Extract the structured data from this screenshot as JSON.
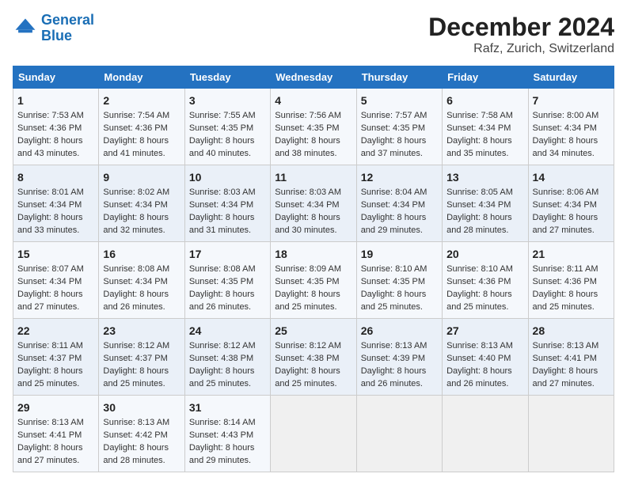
{
  "header": {
    "logo_line1": "General",
    "logo_line2": "Blue",
    "title": "December 2024",
    "subtitle": "Rafz, Zurich, Switzerland"
  },
  "columns": [
    "Sunday",
    "Monday",
    "Tuesday",
    "Wednesday",
    "Thursday",
    "Friday",
    "Saturday"
  ],
  "weeks": [
    [
      {
        "day": "1",
        "lines": [
          "Sunrise: 7:53 AM",
          "Sunset: 4:36 PM",
          "Daylight: 8 hours",
          "and 43 minutes."
        ]
      },
      {
        "day": "2",
        "lines": [
          "Sunrise: 7:54 AM",
          "Sunset: 4:36 PM",
          "Daylight: 8 hours",
          "and 41 minutes."
        ]
      },
      {
        "day": "3",
        "lines": [
          "Sunrise: 7:55 AM",
          "Sunset: 4:35 PM",
          "Daylight: 8 hours",
          "and 40 minutes."
        ]
      },
      {
        "day": "4",
        "lines": [
          "Sunrise: 7:56 AM",
          "Sunset: 4:35 PM",
          "Daylight: 8 hours",
          "and 38 minutes."
        ]
      },
      {
        "day": "5",
        "lines": [
          "Sunrise: 7:57 AM",
          "Sunset: 4:35 PM",
          "Daylight: 8 hours",
          "and 37 minutes."
        ]
      },
      {
        "day": "6",
        "lines": [
          "Sunrise: 7:58 AM",
          "Sunset: 4:34 PM",
          "Daylight: 8 hours",
          "and 35 minutes."
        ]
      },
      {
        "day": "7",
        "lines": [
          "Sunrise: 8:00 AM",
          "Sunset: 4:34 PM",
          "Daylight: 8 hours",
          "and 34 minutes."
        ]
      }
    ],
    [
      {
        "day": "8",
        "lines": [
          "Sunrise: 8:01 AM",
          "Sunset: 4:34 PM",
          "Daylight: 8 hours",
          "and 33 minutes."
        ]
      },
      {
        "day": "9",
        "lines": [
          "Sunrise: 8:02 AM",
          "Sunset: 4:34 PM",
          "Daylight: 8 hours",
          "and 32 minutes."
        ]
      },
      {
        "day": "10",
        "lines": [
          "Sunrise: 8:03 AM",
          "Sunset: 4:34 PM",
          "Daylight: 8 hours",
          "and 31 minutes."
        ]
      },
      {
        "day": "11",
        "lines": [
          "Sunrise: 8:03 AM",
          "Sunset: 4:34 PM",
          "Daylight: 8 hours",
          "and 30 minutes."
        ]
      },
      {
        "day": "12",
        "lines": [
          "Sunrise: 8:04 AM",
          "Sunset: 4:34 PM",
          "Daylight: 8 hours",
          "and 29 minutes."
        ]
      },
      {
        "day": "13",
        "lines": [
          "Sunrise: 8:05 AM",
          "Sunset: 4:34 PM",
          "Daylight: 8 hours",
          "and 28 minutes."
        ]
      },
      {
        "day": "14",
        "lines": [
          "Sunrise: 8:06 AM",
          "Sunset: 4:34 PM",
          "Daylight: 8 hours",
          "and 27 minutes."
        ]
      }
    ],
    [
      {
        "day": "15",
        "lines": [
          "Sunrise: 8:07 AM",
          "Sunset: 4:34 PM",
          "Daylight: 8 hours",
          "and 27 minutes."
        ]
      },
      {
        "day": "16",
        "lines": [
          "Sunrise: 8:08 AM",
          "Sunset: 4:34 PM",
          "Daylight: 8 hours",
          "and 26 minutes."
        ]
      },
      {
        "day": "17",
        "lines": [
          "Sunrise: 8:08 AM",
          "Sunset: 4:35 PM",
          "Daylight: 8 hours",
          "and 26 minutes."
        ]
      },
      {
        "day": "18",
        "lines": [
          "Sunrise: 8:09 AM",
          "Sunset: 4:35 PM",
          "Daylight: 8 hours",
          "and 25 minutes."
        ]
      },
      {
        "day": "19",
        "lines": [
          "Sunrise: 8:10 AM",
          "Sunset: 4:35 PM",
          "Daylight: 8 hours",
          "and 25 minutes."
        ]
      },
      {
        "day": "20",
        "lines": [
          "Sunrise: 8:10 AM",
          "Sunset: 4:36 PM",
          "Daylight: 8 hours",
          "and 25 minutes."
        ]
      },
      {
        "day": "21",
        "lines": [
          "Sunrise: 8:11 AM",
          "Sunset: 4:36 PM",
          "Daylight: 8 hours",
          "and 25 minutes."
        ]
      }
    ],
    [
      {
        "day": "22",
        "lines": [
          "Sunrise: 8:11 AM",
          "Sunset: 4:37 PM",
          "Daylight: 8 hours",
          "and 25 minutes."
        ]
      },
      {
        "day": "23",
        "lines": [
          "Sunrise: 8:12 AM",
          "Sunset: 4:37 PM",
          "Daylight: 8 hours",
          "and 25 minutes."
        ]
      },
      {
        "day": "24",
        "lines": [
          "Sunrise: 8:12 AM",
          "Sunset: 4:38 PM",
          "Daylight: 8 hours",
          "and 25 minutes."
        ]
      },
      {
        "day": "25",
        "lines": [
          "Sunrise: 8:12 AM",
          "Sunset: 4:38 PM",
          "Daylight: 8 hours",
          "and 25 minutes."
        ]
      },
      {
        "day": "26",
        "lines": [
          "Sunrise: 8:13 AM",
          "Sunset: 4:39 PM",
          "Daylight: 8 hours",
          "and 26 minutes."
        ]
      },
      {
        "day": "27",
        "lines": [
          "Sunrise: 8:13 AM",
          "Sunset: 4:40 PM",
          "Daylight: 8 hours",
          "and 26 minutes."
        ]
      },
      {
        "day": "28",
        "lines": [
          "Sunrise: 8:13 AM",
          "Sunset: 4:41 PM",
          "Daylight: 8 hours",
          "and 27 minutes."
        ]
      }
    ],
    [
      {
        "day": "29",
        "lines": [
          "Sunrise: 8:13 AM",
          "Sunset: 4:41 PM",
          "Daylight: 8 hours",
          "and 27 minutes."
        ]
      },
      {
        "day": "30",
        "lines": [
          "Sunrise: 8:13 AM",
          "Sunset: 4:42 PM",
          "Daylight: 8 hours",
          "and 28 minutes."
        ]
      },
      {
        "day": "31",
        "lines": [
          "Sunrise: 8:14 AM",
          "Sunset: 4:43 PM",
          "Daylight: 8 hours",
          "and 29 minutes."
        ]
      },
      null,
      null,
      null,
      null
    ]
  ]
}
